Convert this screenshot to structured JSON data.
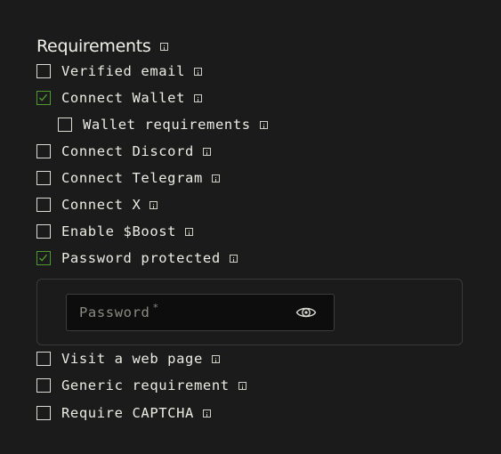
{
  "section": {
    "title": "Requirements"
  },
  "requirements": [
    {
      "label": "Verified email",
      "checked": false
    },
    {
      "label": "Connect Wallet",
      "checked": true
    },
    {
      "label": "Wallet requirements",
      "checked": false,
      "nested": true
    },
    {
      "label": "Connect Discord",
      "checked": false
    },
    {
      "label": "Connect Telegram",
      "checked": false
    },
    {
      "label": "Connect X",
      "checked": false
    },
    {
      "label": "Enable $Boost",
      "checked": false
    },
    {
      "label": "Password protected",
      "checked": true
    },
    {
      "label": "Visit a web page",
      "checked": false
    },
    {
      "label": "Generic requirement",
      "checked": false
    },
    {
      "label": "Require CAPTCHA",
      "checked": false
    }
  ],
  "password": {
    "placeholder": "Password",
    "required_mark": "*",
    "toggle_icon": "eye-icon"
  },
  "colors": {
    "background": "#1b1b1b",
    "checked_accent": "#4d9a2e",
    "text": "#ecece4"
  }
}
